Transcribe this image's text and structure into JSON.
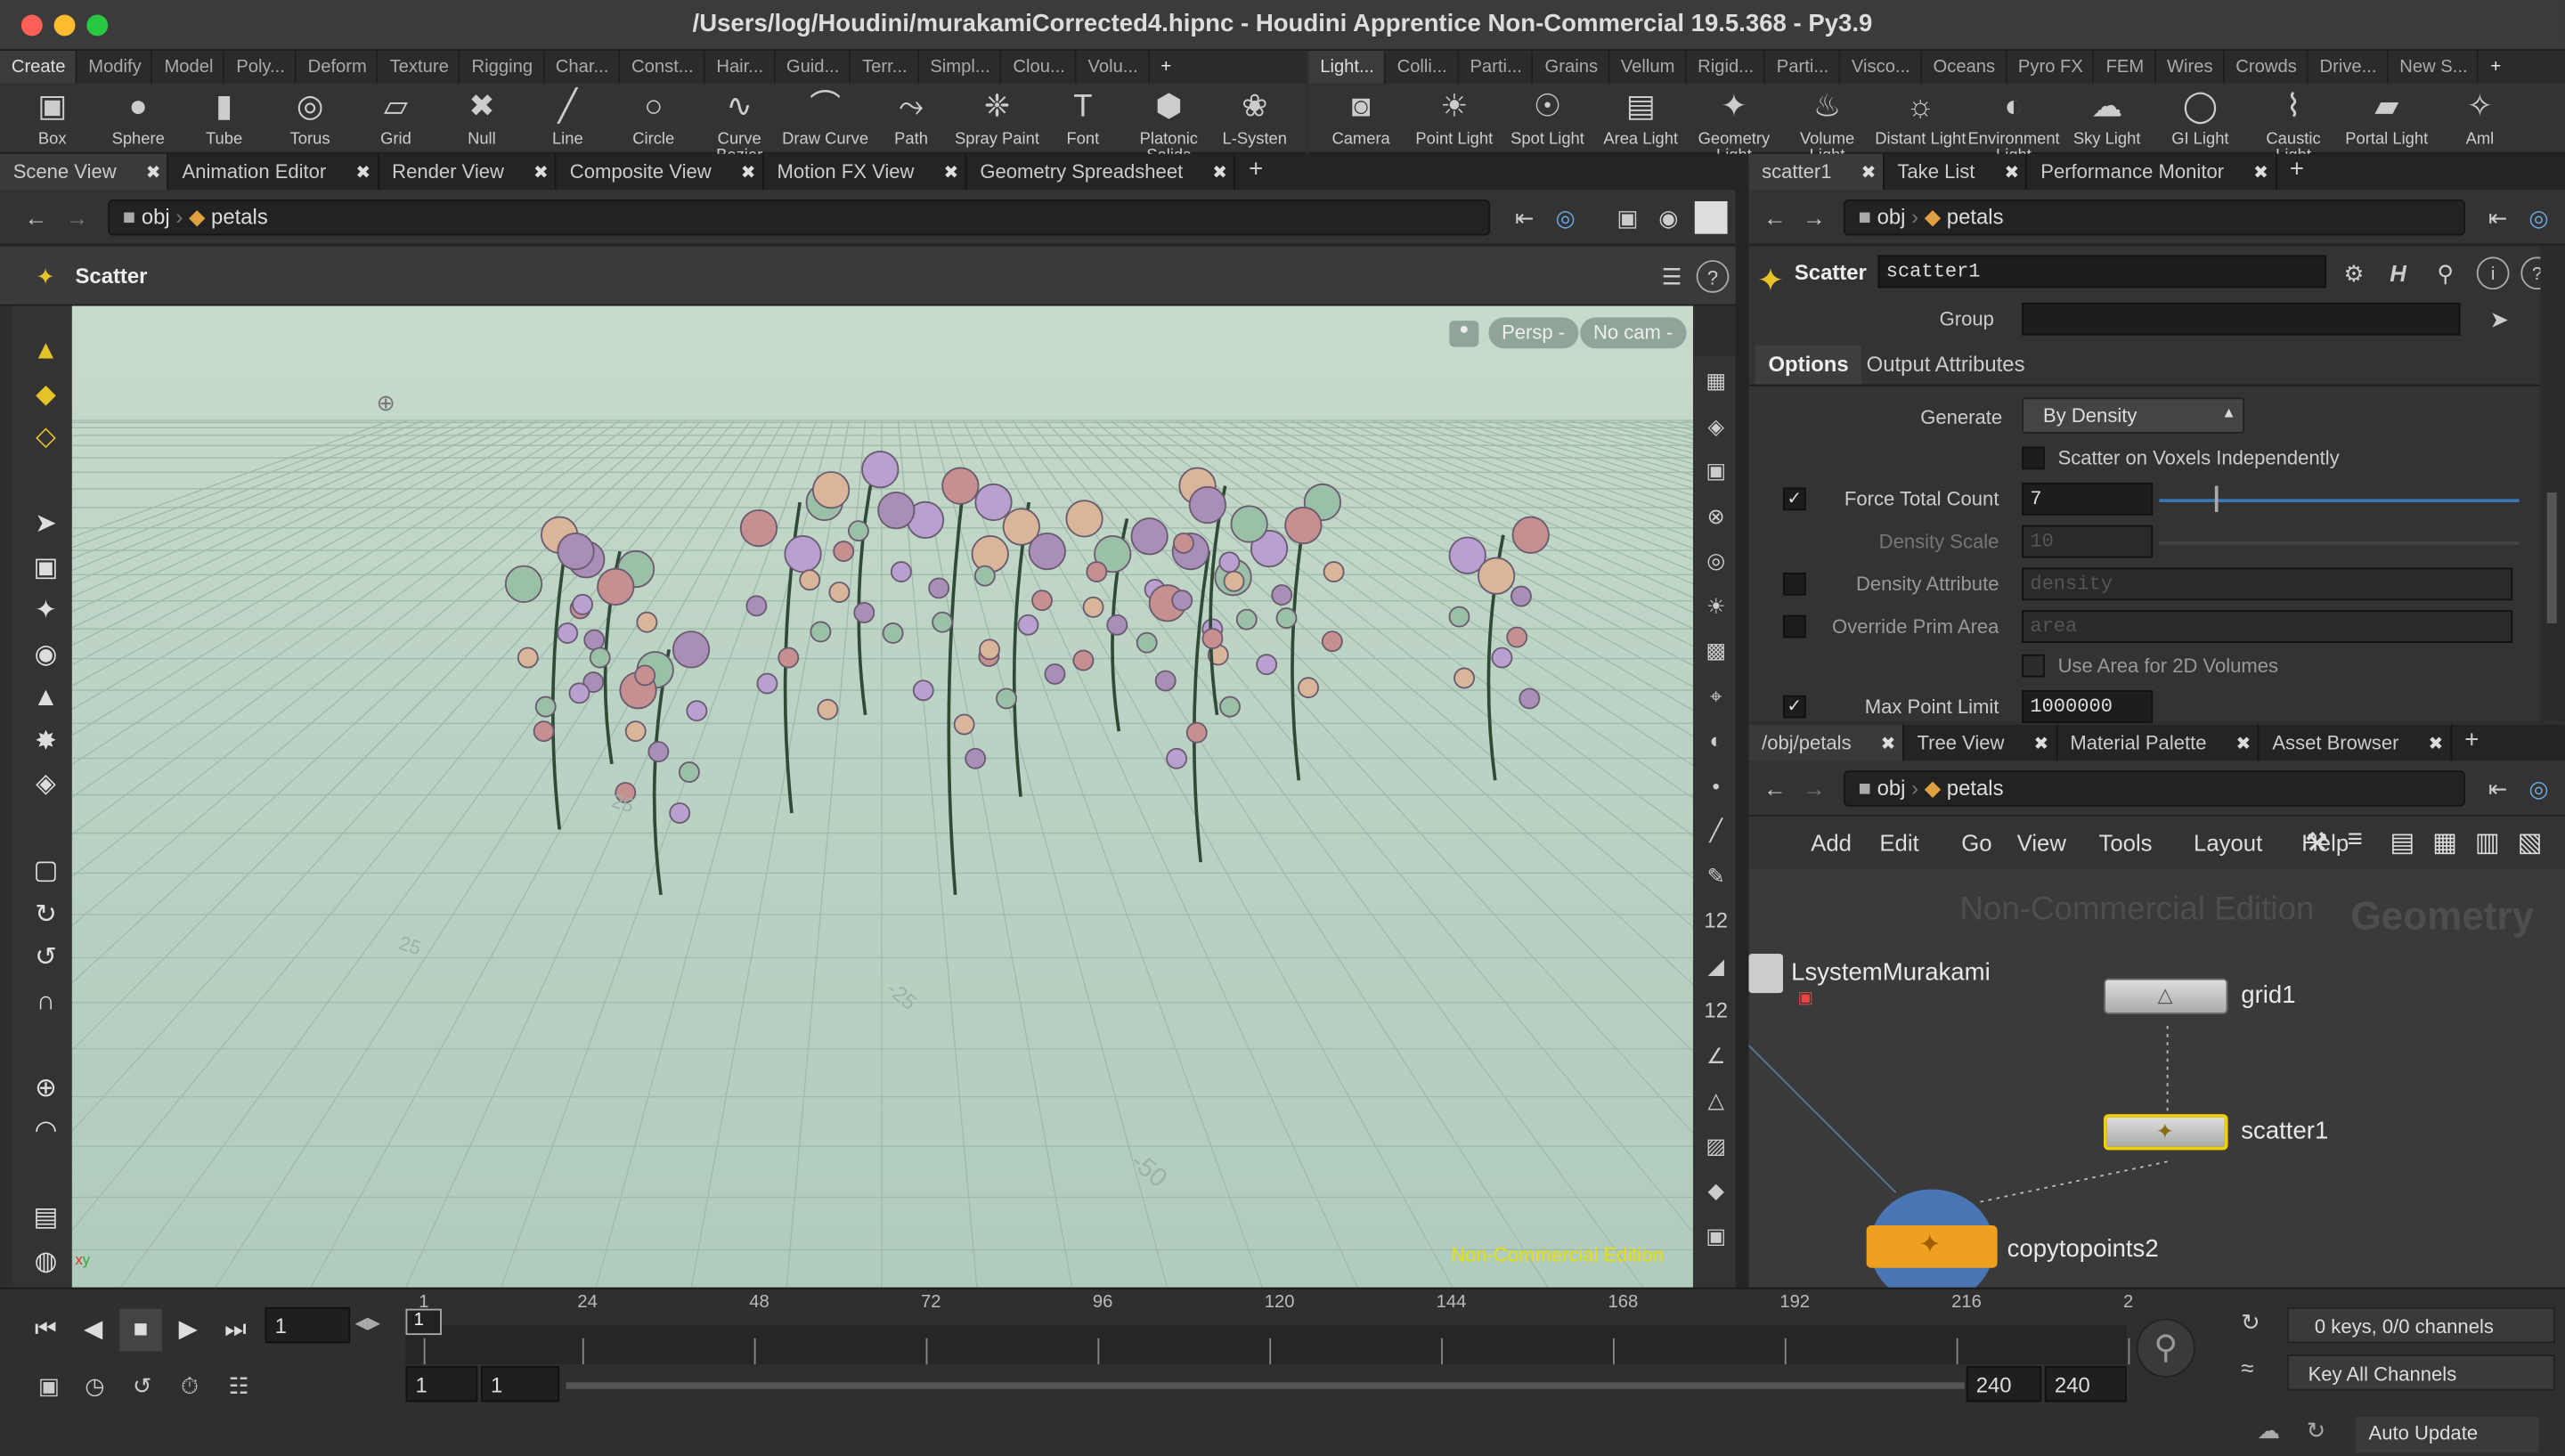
{
  "window": {
    "title": "/Users/log/Houdini/murakamiCorrected4.hipnc - Houdini Apprentice Non-Commercial 19.5.368 - Py3.9"
  },
  "shelf_tabs_left": [
    "Create",
    "Modify",
    "Model",
    "Poly...",
    "Deform",
    "Texture",
    "Rigging",
    "Char...",
    "Const...",
    "Hair...",
    "Guid...",
    "Terr...",
    "Simpl...",
    "Clou...",
    "Volu..."
  ],
  "shelf_tabs_right": [
    "Light...",
    "Colli...",
    "Parti...",
    "Grains",
    "Vellum",
    "Rigid...",
    "Parti...",
    "Visco...",
    "Oceans",
    "Pyro FX",
    "FEM",
    "Wires",
    "Crowds",
    "Drive...",
    "New S..."
  ],
  "shelf_tools_left": [
    {
      "label": "Box",
      "icon": "box-icon"
    },
    {
      "label": "Sphere",
      "icon": "sphere-icon"
    },
    {
      "label": "Tube",
      "icon": "tube-icon"
    },
    {
      "label": "Torus",
      "icon": "torus-icon"
    },
    {
      "label": "Grid",
      "icon": "grid-icon"
    },
    {
      "label": "Null",
      "icon": "null-icon"
    },
    {
      "label": "Line",
      "icon": "line-icon"
    },
    {
      "label": "Circle",
      "icon": "circle-icon"
    },
    {
      "label": "Curve Bezier",
      "icon": "curve-bezier-icon"
    },
    {
      "label": "Draw Curve",
      "icon": "draw-curve-icon"
    },
    {
      "label": "Path",
      "icon": "path-icon"
    },
    {
      "label": "Spray Paint",
      "icon": "spray-paint-icon"
    },
    {
      "label": "Font",
      "icon": "font-icon"
    },
    {
      "label": "Platonic Solids",
      "icon": "platonic-solids-icon"
    },
    {
      "label": "L-Systen",
      "icon": "l-system-icon"
    }
  ],
  "shelf_tools_right": [
    {
      "label": "Camera",
      "icon": "camera-icon"
    },
    {
      "label": "Point Light",
      "icon": "point-light-icon"
    },
    {
      "label": "Spot Light",
      "icon": "spot-light-icon"
    },
    {
      "label": "Area Light",
      "icon": "area-light-icon"
    },
    {
      "label": "Geometry Light",
      "icon": "geometry-light-icon"
    },
    {
      "label": "Volume Light",
      "icon": "volume-light-icon"
    },
    {
      "label": "Distant Light",
      "icon": "distant-light-icon"
    },
    {
      "label": "Environment Light",
      "icon": "environment-light-icon"
    },
    {
      "label": "Sky Light",
      "icon": "sky-light-icon"
    },
    {
      "label": "GI Light",
      "icon": "gi-light-icon"
    },
    {
      "label": "Caustic Light",
      "icon": "caustic-light-icon"
    },
    {
      "label": "Portal Light",
      "icon": "portal-light-icon"
    },
    {
      "label": "Aml",
      "icon": "ambient-light-icon"
    }
  ],
  "left_pane_tabs": [
    "Scene View",
    "Animation Editor",
    "Render View",
    "Composite View",
    "Motion FX View",
    "Geometry Spreadsheet"
  ],
  "nav": {
    "obj": "obj",
    "geo": "petals"
  },
  "viewport": {
    "tool": "Scatter",
    "persp": "Persp -",
    "cam": "No cam -",
    "watermark": "Non-Commercial Edition",
    "grid_labels": [
      "25",
      "25",
      "-25",
      "-50"
    ]
  },
  "param_tabs": [
    "scatter1",
    "Take List",
    "Performance Monitor"
  ],
  "params": {
    "node_type": "Scatter",
    "node_name": "scatter1",
    "group_label": "Group",
    "group_value": "",
    "subtabs": [
      "Options",
      "Output Attributes"
    ],
    "generate_label": "Generate",
    "generate_value": "By Density",
    "voxels_label": "Scatter on Voxels Independently",
    "force_label": "Force Total Count",
    "force_value": "7",
    "density_scale_label": "Density Scale",
    "density_scale_value": "10",
    "density_attr_label": "Density Attribute",
    "density_attr_value": "density",
    "override_label": "Override Prim Area",
    "override_value": "area",
    "use_area_label": "Use Area for 2D Volumes",
    "max_label": "Max Point Limit",
    "max_value": "1000000"
  },
  "net_tabs": [
    "/obj/petals",
    "Tree View",
    "Material Palette",
    "Asset Browser"
  ],
  "net_menu": [
    "Add",
    "Edit",
    "Go",
    "View",
    "Tools",
    "Layout",
    "Help"
  ],
  "net": {
    "wm1": "Non-Commercial Edition",
    "wm2": "Geometry",
    "nodes": [
      "LsystemMurakami",
      "grid1",
      "scatter1",
      "copytopoints2"
    ]
  },
  "timeline": {
    "frame": "1",
    "ticks": [
      "1",
      "24",
      "48",
      "72",
      "96",
      "120",
      "144",
      "168",
      "192",
      "216",
      "2"
    ],
    "start": "1",
    "start2": "1",
    "end": "240",
    "end2": "240",
    "keys": "0 keys, 0/0 channels",
    "key_all": "Key All Channels",
    "auto_update": "Auto Update"
  },
  "colors": {
    "accent": "#e6c229",
    "selected_node": "#f0d000",
    "watermark": "#e8e000"
  }
}
